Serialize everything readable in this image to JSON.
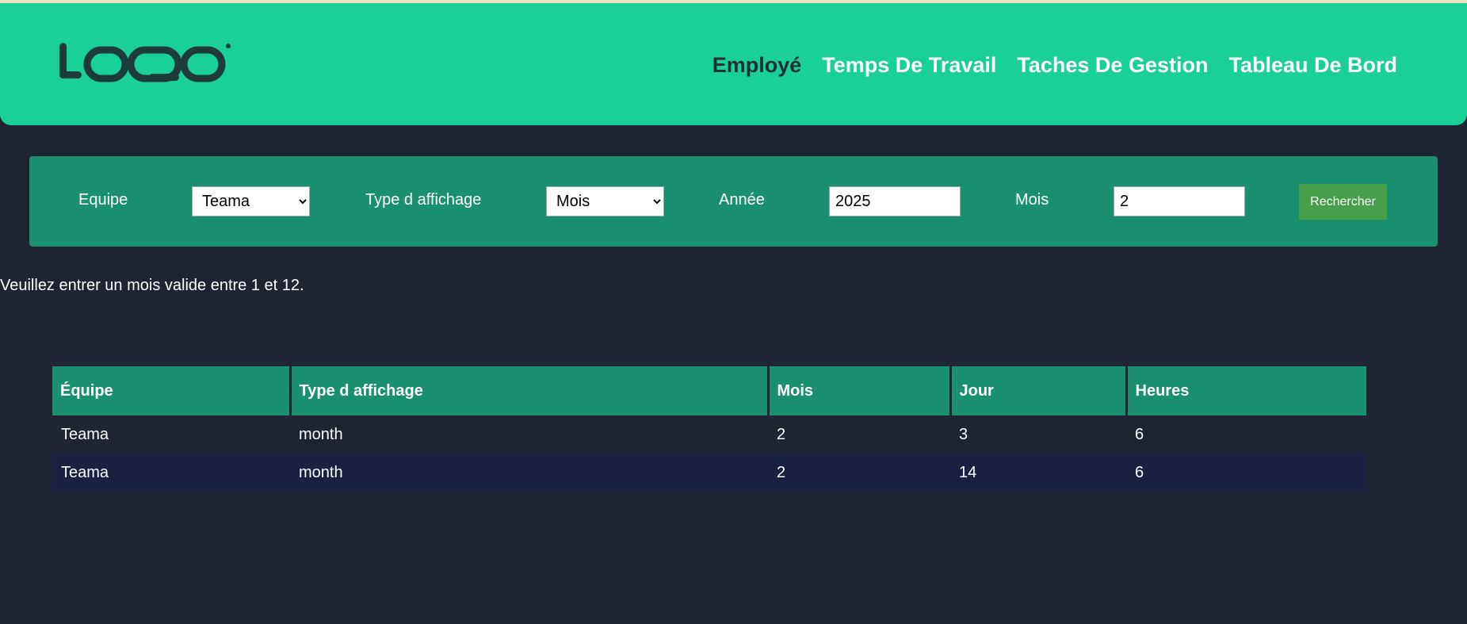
{
  "nav": {
    "logo_alt": "logo",
    "items": [
      {
        "label": "Employé",
        "active": true
      },
      {
        "label": "Temps De Travail",
        "active": false
      },
      {
        "label": "Taches De Gestion",
        "active": false
      },
      {
        "label": "Tableau De Bord",
        "active": false
      }
    ]
  },
  "filters": {
    "team_label": "Equipe",
    "team_value": "Teama",
    "display_label": "Type d affichage",
    "display_value": "Mois",
    "year_label": "Année",
    "year_value": "2025",
    "month_label": "Mois",
    "month_value": "2",
    "search_label": "Rechercher"
  },
  "message": "Veuillez entrer un mois valide entre 1 et 12.",
  "table": {
    "headers": [
      "Équipe",
      "Type d affichage",
      "Mois",
      "Jour",
      "Heures"
    ],
    "rows": [
      [
        "Teama",
        "month",
        "2",
        "3",
        "6"
      ],
      [
        "Teama",
        "month",
        "2",
        "14",
        "6"
      ]
    ]
  },
  "colors": {
    "header_bg": "#19d197",
    "filter_bg": "#1b9070",
    "page_bg": "#1e2432",
    "button_bg": "#45a049",
    "alt_row_bg": "#1a2040"
  }
}
